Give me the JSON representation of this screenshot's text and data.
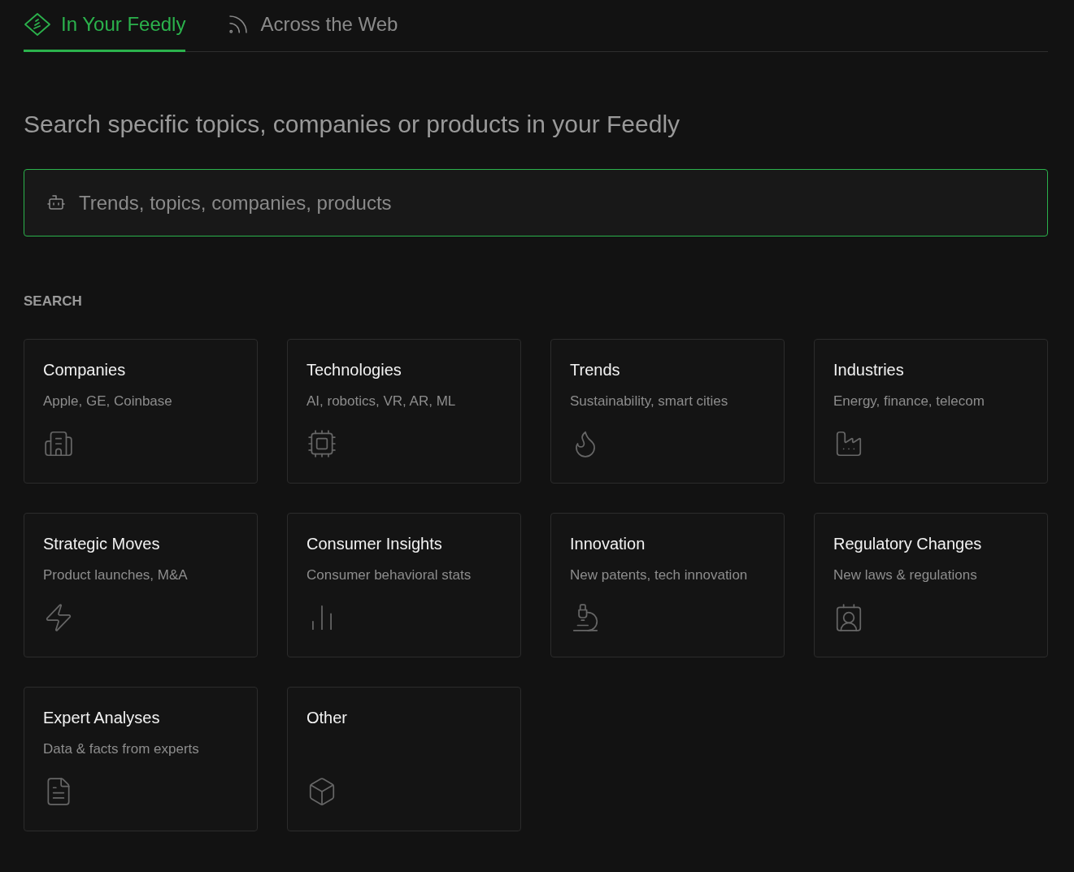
{
  "tabs": [
    {
      "label": "In Your Feedly",
      "kind": "feedly",
      "selected": true
    },
    {
      "label": "Across the Web",
      "kind": "web",
      "selected": false
    }
  ],
  "heading": "Search specific topics, companies or products in your Feedly",
  "search": {
    "placeholder": "Trends, topics, companies, products"
  },
  "section_label": "SEARCH",
  "cards": [
    {
      "title": "Companies",
      "subtitle": "Apple, GE, Coinbase",
      "kind": "building"
    },
    {
      "title": "Technologies",
      "subtitle": "AI, robotics, VR, AR, ML",
      "kind": "chip"
    },
    {
      "title": "Trends",
      "subtitle": "Sustainability, smart cities",
      "kind": "flame"
    },
    {
      "title": "Industries",
      "subtitle": "Energy, finance, telecom",
      "kind": "factory"
    },
    {
      "title": "Strategic Moves",
      "subtitle": "Product launches, M&A",
      "kind": "lightning"
    },
    {
      "title": "Consumer Insights",
      "subtitle": "Consumer behavioral stats",
      "kind": "chart"
    },
    {
      "title": "Innovation",
      "subtitle": "New patents, tech innovation",
      "kind": "microscope"
    },
    {
      "title": "Regulatory Changes",
      "subtitle": "New laws & regulations",
      "kind": "contact"
    },
    {
      "title": "Expert Analyses",
      "subtitle": "Data & facts from experts",
      "kind": "document"
    },
    {
      "title": "Other",
      "kind": "cube"
    }
  ]
}
